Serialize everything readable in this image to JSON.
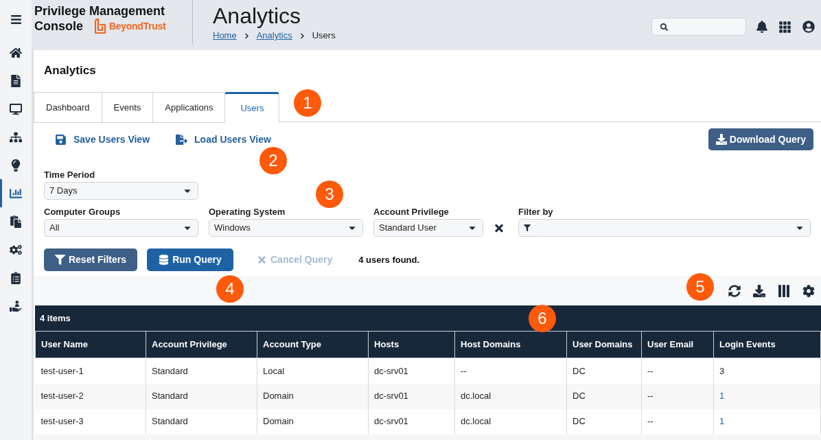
{
  "app": {
    "title_lines": [
      "Privilege Management",
      "Console"
    ],
    "logo_text": "BeyondTrust"
  },
  "sidebar": {
    "items": [
      {
        "kind": "home",
        "selected": false
      },
      {
        "kind": "document",
        "selected": false
      },
      {
        "kind": "monitor",
        "selected": false
      },
      {
        "kind": "network",
        "selected": false
      },
      {
        "kind": "lightbulb",
        "selected": false
      },
      {
        "kind": "chart",
        "selected": true
      },
      {
        "kind": "clipboard",
        "selected": false
      },
      {
        "kind": "gears",
        "selected": false
      },
      {
        "kind": "checklist",
        "selected": false
      },
      {
        "kind": "hand",
        "selected": false
      }
    ]
  },
  "header": {
    "page_title": "Analytics",
    "breadcrumb": [
      {
        "label": "Home",
        "link": true
      },
      {
        "label": "Analytics",
        "link": true
      },
      {
        "label": "Users",
        "link": false
      }
    ]
  },
  "content": {
    "heading": "Analytics",
    "tabs": [
      {
        "label": "Dashboard",
        "selected": false
      },
      {
        "label": "Events",
        "selected": false
      },
      {
        "label": "Applications",
        "selected": false
      },
      {
        "label": "Users",
        "selected": true
      }
    ],
    "view_actions": [
      {
        "kind": "save",
        "label": "Save Users View"
      },
      {
        "kind": "load",
        "label": "Load Users View"
      }
    ],
    "download_button": "Download Query"
  },
  "filters": {
    "time_period": {
      "label": "Time Period",
      "value": "7 Days"
    },
    "fields": [
      {
        "kind": "select",
        "label": "Computer Groups",
        "value": "All",
        "clearable": false
      },
      {
        "kind": "select",
        "label": "Operating System",
        "value": "Windows",
        "clearable": false
      },
      {
        "kind": "select",
        "label": "Account Privilege",
        "value": "Standard User",
        "clearable": true
      },
      {
        "kind": "filter",
        "label": "Filter by"
      }
    ]
  },
  "query_buttons": [
    {
      "kind": "reset",
      "label": "Reset Filters",
      "disabled": false
    },
    {
      "kind": "run",
      "label": "Run Query",
      "disabled": false
    },
    {
      "kind": "cancel",
      "label": "Cancel Query",
      "disabled": true
    }
  ],
  "result_text": "4 users found.",
  "table": {
    "item_count": "4 items",
    "columns": [
      "User Name",
      "Account Privilege",
      "Account Type",
      "Hosts",
      "Host Domains",
      "User Domains",
      "User Email",
      "Login Events"
    ],
    "rows": [
      {
        "cells": [
          "test-user-1",
          "Standard",
          "Local",
          "dc-srv01",
          "--",
          "DC",
          "--",
          "3"
        ],
        "events_link": false
      },
      {
        "cells": [
          "test-user-2",
          "Standard",
          "Domain",
          "dc-srv01",
          "dc.local",
          "DC",
          "--",
          "1"
        ],
        "events_link": true
      },
      {
        "cells": [
          "test-user-3",
          "Standard",
          "Domain",
          "dc-srv01",
          "dc.local",
          "DC",
          "--",
          "1"
        ],
        "events_link": true
      }
    ]
  },
  "callouts": [
    "1",
    "2",
    "3",
    "4",
    "5",
    "6"
  ]
}
